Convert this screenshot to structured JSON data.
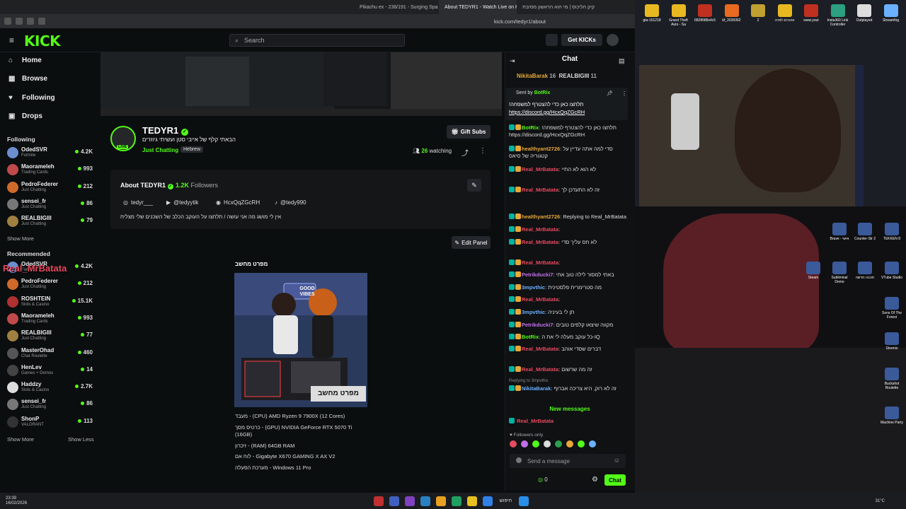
{
  "browser": {
    "tabs": [
      {
        "label": "Pikachu ex - 238/191 - Surging Spa"
      },
      {
        "label": "About TEDYR1 - Watch Live on K"
      },
      {
        "label": "קיק הליכוס | מי הוא הראשון מסיבת"
      }
    ],
    "url": "kick.com/tedyr1/about"
  },
  "header": {
    "logo": "KICK",
    "search_placeholder": "Search",
    "get_kicks": "Get KICKs"
  },
  "sidebar": {
    "nav": [
      {
        "label": "Home",
        "icon": "home-icon"
      },
      {
        "label": "Browse",
        "icon": "browse-icon"
      },
      {
        "label": "Following",
        "icon": "heart-icon"
      },
      {
        "label": "Drops",
        "icon": "drops-icon"
      }
    ],
    "following_title": "Following",
    "following": [
      {
        "name": "OdedSVR",
        "category": "Fortnite",
        "viewers": "4.2K",
        "color": "#6a8fd0"
      },
      {
        "name": "Maorameleh",
        "category": "Trading Cards",
        "viewers": "993",
        "color": "#c04a4a"
      },
      {
        "name": "PedroFederer",
        "category": "Just Chatting",
        "viewers": "212",
        "color": "#d06a2a"
      },
      {
        "name": "sensei_fr",
        "category": "Just Chatting",
        "viewers": "86",
        "color": "#777"
      },
      {
        "name": "REALBIGIII",
        "category": "Just Chatting",
        "viewers": "79",
        "color": "#a08040"
      }
    ],
    "show_more": "Show More",
    "recommended_title": "Recommended",
    "recommended": [
      {
        "name": "OdedSVR",
        "category": "Fortnite",
        "viewers": "4.2K",
        "color": "#6a8fd0"
      },
      {
        "name": "PedroFederer",
        "category": "Just Chatting",
        "viewers": "212",
        "color": "#d06a2a"
      },
      {
        "name": "ROSHTEIN",
        "category": "Slots & Casino",
        "viewers": "15.1K",
        "color": "#b03030"
      },
      {
        "name": "Maorameleh",
        "category": "Trading Cards",
        "viewers": "993",
        "color": "#c04a4a"
      },
      {
        "name": "REALBIGIII",
        "category": "Just Chatting",
        "viewers": "77",
        "color": "#a08040"
      },
      {
        "name": "MasterOhad",
        "category": "Chat Roulette",
        "viewers": "460",
        "color": "#555"
      },
      {
        "name": "HenLev",
        "category": "Games + Demos",
        "viewers": "14",
        "color": "#444"
      },
      {
        "name": "Haddzy",
        "category": "Slots & Casino",
        "viewers": "2.7K",
        "color": "#ddd"
      },
      {
        "name": "sensei_fr",
        "category": "Just Chatting",
        "viewers": "86",
        "color": "#777"
      },
      {
        "name": "ShonP",
        "category": "VALORANT",
        "viewers": "113",
        "color": "#333"
      }
    ],
    "show_less": "Show Less"
  },
  "overlay": {
    "name": "Real_MrBatata"
  },
  "channel": {
    "name": "TEDYR1",
    "live": "LIVE",
    "title": "הבאתי קלף של אייבי סטן ועשיתי גיוזרים",
    "category": "Just Chatting",
    "language": "Hebrew",
    "watching_count": "26",
    "watching_label": "watching",
    "gift_subs": "Gift Subs"
  },
  "about": {
    "title": "About TEDYR1",
    "followers_count": "1.2K",
    "followers_label": "Followers",
    "socials": [
      {
        "icon": "instagram-icon",
        "label": "tedyr___"
      },
      {
        "icon": "youtube-icon",
        "label": "@tedyytik"
      },
      {
        "icon": "discord-icon",
        "label": "HcxQqZGcRH"
      },
      {
        "icon": "tiktok-icon",
        "label": "@tedy990"
      }
    ],
    "description": "אין לי מושג מה אני עושה / תלחצו על העוקב הכלב של השכנים שלי מצליח",
    "edit_panel": "Edit Panel"
  },
  "panel": {
    "title": "מפרט מחשב",
    "image_caption": "מפרט מחשב",
    "image_text": "GOOD VIBES",
    "specs": [
      "מעבד - (CPU) AMD Ryzen 9 7900X (12 Cores)",
      "כרטיס מסך - (GPU) NVIDIA GeForce RTX 5070 Ti",
      "(16GB)",
      "זיכרון - (RAM) 64GB RAM",
      "לוח אם - Gigabyte X670 GAMING X AX V2",
      "מערכת הפעלה - Windows 11 Pro"
    ]
  },
  "chat": {
    "title": "Chat",
    "top_users": [
      {
        "name": "NikitaBarak",
        "count": "16"
      },
      {
        "name": "REALBIGIII",
        "count": "11"
      }
    ],
    "pinned_by": "Sent by",
    "pinned_user": "BotRix",
    "pinned_text": "!תלחצו כאן כדי להצטרף למשפחה",
    "pinned_link": "https://discord.gg/HcxQqZGcRH",
    "messages": [
      {
        "user": "BotRix",
        "color": "#53fc18",
        "text": "!תלחצו כאן כדי להצטרף למשפחה https://discord.gg/HcxQqZGcRH"
      },
      {
        "user": "healthyant2726",
        "color": "#e8a838",
        "text": "סדי למה אתה עדיין על קטגוריה של סיאס"
      },
      {
        "user": "Real_MrBatata",
        "color": "#e84a5f",
        "text": "לא הוא לא התיי"
      },
      {
        "user": "Real_MrBatata",
        "color": "#e84a5f",
        "text": "זה לא התעדכן לך"
      },
      {
        "user": "healthyant2726",
        "color": "#e8a838",
        "text": "Replying to Real_MrBatata"
      },
      {
        "user": "Real_MrBatata",
        "color": "#e84a5f",
        "text": ""
      },
      {
        "user": "Real_MrBatata",
        "color": "#e84a5f",
        "text": "לא חס עליך סדי"
      },
      {
        "user": "Real_MrBatata",
        "color": "#e84a5f",
        "text": ""
      },
      {
        "user": "Petrikducki7",
        "color": "#c070e8",
        "text": "באתי למסור לילה טוב אחי"
      },
      {
        "user": "3mpvthic",
        "color": "#6ab0ff",
        "text": "מה סטרימרית פלסטינית"
      },
      {
        "user": "Real_MrBatata",
        "color": "#e84a5f",
        "text": ""
      },
      {
        "user": "3mpvthic",
        "color": "#6ab0ff",
        "text": "תן לי בעיניה"
      },
      {
        "user": "Petrikducki7",
        "color": "#c070e8",
        "text": "מקווה שיצאו קלפים טובים"
      },
      {
        "user": "BotRix",
        "color": "#53fc18",
        "text": "כל עוקב מעלה לי את ה-IQ"
      },
      {
        "user": "Real_MrBatata",
        "color": "#e84a5f",
        "text": "דברים שסדי אוהב"
      },
      {
        "user": "Real_MrBatata",
        "color": "#e84a5f",
        "text": "זה מה שרשום"
      },
      {
        "user": "NikitaBarak",
        "color": "#6ab0ff",
        "text": "זה לא רוק, היא צריכה אברוף"
      }
    ],
    "replying_to": "Replying to 3mpvthic",
    "new_messages": "New messages",
    "last_message_user": "Real_MrBatata",
    "followers_only": "Followers only",
    "input_placeholder": "Send a message",
    "points": "0",
    "send": "Chat"
  },
  "desktop": {
    "icons": [
      {
        "label": "gta-151218"
      },
      {
        "label": "Grand Theft Auto - Sa"
      },
      {
        "label": "6828688s4c5"
      },
      {
        "label": "kf_2026062"
      },
      {
        "label": "2"
      },
      {
        "label": "אינוכים לפניכ"
      },
      {
        "label": "www.yout"
      },
      {
        "label": "Insta360 Link Controller"
      },
      {
        "label": "Outplayed"
      },
      {
        "label": "Streamfog"
      }
    ],
    "side_icons": [
      {
        "label": "Steam"
      },
      {
        "label": "Subliminal Demo"
      },
      {
        "label": "תוכנה חדשה"
      },
      {
        "label": "VTube Studio"
      },
      {
        "label": "Brave - אישי"
      },
      {
        "label": "Counter-Str 2"
      },
      {
        "label": "TEKKEN 8"
      },
      {
        "label": "Sons Of The Forest"
      },
      {
        "label": "Stremio"
      },
      {
        "label": "Buckshot Roulette"
      },
      {
        "label": "Machine Party"
      }
    ],
    "taskbar_time": "23:39",
    "taskbar_date": "16/02/2026",
    "taskbar_temp": "31°C",
    "taskbar_search": "חיפוש"
  }
}
